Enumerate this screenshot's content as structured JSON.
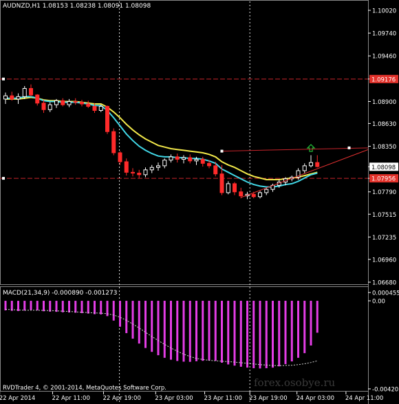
{
  "symbol_header": "AUDNZD,H1  1.08153 1.08238 1.08091 1.08098",
  "macd_header": "MACD(21,34,9) -0.000890 -0.001273",
  "copyright": "RVDTrader 4, © 2001-2014, MetaQuotes Software Corp.",
  "watermark": "forex.osobye.ru",
  "colors": {
    "background": "#000000",
    "bull_candle": "#ffffff",
    "bear_candle": "#ff2a2a",
    "ma_fast": "#41d7e6",
    "ma_slow": "#f2e84a",
    "level_line": "#c9242b",
    "trend_line": "#e03030",
    "macd_hist": "#e43de6",
    "macd_signal": "#d6d6d6",
    "current_price_box": "#ffffff",
    "level_price_box": "#e3322b",
    "up_arrow": "#23c43a"
  },
  "chart_data": [
    {
      "type": "candlestick",
      "title": "AUDNZD,H1",
      "ohlc_header": {
        "open": 1.08153,
        "high": 1.08238,
        "low": 1.08091,
        "close": 1.08098
      },
      "y_ticks": [
        "1.10020",
        "1.09740",
        "1.09460",
        "1.09176",
        "1.08900",
        "1.08630",
        "1.08350",
        "1.08098",
        "1.07956",
        "1.07790",
        "1.07515",
        "1.07235",
        "1.06960",
        "1.06680"
      ],
      "ylim": [
        1.0668,
        1.1002
      ],
      "x_ticks": [
        "22 Apr 2014",
        "22 Apr 11:00",
        "22 Apr 19:00",
        "23 Apr 03:00",
        "23 Apr 11:00",
        "23 Apr 19:00",
        "24 Apr 03:00",
        "24 Apr 11:00"
      ],
      "horizontal_levels": [
        {
          "price": 1.09176,
          "label": "1.09176"
        },
        {
          "price": 1.07956,
          "label": "1.07956"
        }
      ],
      "current_price": {
        "price": 1.08098,
        "label": "1.08098"
      },
      "resistance_line": [
        {
          "bar": 34,
          "price": 1.0829
        },
        {
          "bar": 54,
          "price": 1.0833
        }
      ],
      "trend_line": [
        {
          "bar": 37,
          "price": 1.0772
        },
        {
          "bar": 56,
          "price": 1.0828
        }
      ],
      "candles": [
        {
          "o": 1.0893,
          "h": 1.0901,
          "l": 1.0887,
          "c": 1.0897
        },
        {
          "o": 1.0897,
          "h": 1.0902,
          "l": 1.0891,
          "c": 1.0893
        },
        {
          "o": 1.0893,
          "h": 1.09,
          "l": 1.0887,
          "c": 1.0896
        },
        {
          "o": 1.0896,
          "h": 1.0909,
          "l": 1.0893,
          "c": 1.0906
        },
        {
          "o": 1.0906,
          "h": 1.0911,
          "l": 1.0896,
          "c": 1.0898
        },
        {
          "o": 1.0898,
          "h": 1.0899,
          "l": 1.0885,
          "c": 1.0888
        },
        {
          "o": 1.0888,
          "h": 1.0892,
          "l": 1.0876,
          "c": 1.088
        },
        {
          "o": 1.088,
          "h": 1.0889,
          "l": 1.0877,
          "c": 1.0886
        },
        {
          "o": 1.0886,
          "h": 1.0893,
          "l": 1.0882,
          "c": 1.0891
        },
        {
          "o": 1.0891,
          "h": 1.0894,
          "l": 1.0884,
          "c": 1.0886
        },
        {
          "o": 1.0886,
          "h": 1.0893,
          "l": 1.0883,
          "c": 1.089
        },
        {
          "o": 1.089,
          "h": 1.0894,
          "l": 1.0886,
          "c": 1.0889
        },
        {
          "o": 1.0889,
          "h": 1.0892,
          "l": 1.0884,
          "c": 1.0887
        },
        {
          "o": 1.0887,
          "h": 1.0891,
          "l": 1.0882,
          "c": 1.0884
        },
        {
          "o": 1.0884,
          "h": 1.0888,
          "l": 1.0876,
          "c": 1.0879
        },
        {
          "o": 1.0879,
          "h": 1.0886,
          "l": 1.0877,
          "c": 1.0884
        },
        {
          "o": 1.0884,
          "h": 1.0885,
          "l": 1.085,
          "c": 1.0853
        },
        {
          "o": 1.0853,
          "h": 1.0857,
          "l": 1.0824,
          "c": 1.0827
        },
        {
          "o": 1.0827,
          "h": 1.0829,
          "l": 1.0812,
          "c": 1.0816
        },
        {
          "o": 1.0816,
          "h": 1.082,
          "l": 1.0799,
          "c": 1.0803
        },
        {
          "o": 1.0803,
          "h": 1.0808,
          "l": 1.0798,
          "c": 1.0802
        },
        {
          "o": 1.0802,
          "h": 1.0806,
          "l": 1.0796,
          "c": 1.08
        },
        {
          "o": 1.08,
          "h": 1.0809,
          "l": 1.0797,
          "c": 1.0806
        },
        {
          "o": 1.0806,
          "h": 1.0812,
          "l": 1.0802,
          "c": 1.0809
        },
        {
          "o": 1.0809,
          "h": 1.0815,
          "l": 1.0805,
          "c": 1.0811
        },
        {
          "o": 1.0811,
          "h": 1.082,
          "l": 1.0808,
          "c": 1.0818
        },
        {
          "o": 1.0818,
          "h": 1.0825,
          "l": 1.0815,
          "c": 1.0822
        },
        {
          "o": 1.0822,
          "h": 1.0826,
          "l": 1.0815,
          "c": 1.0819
        },
        {
          "o": 1.0819,
          "h": 1.0824,
          "l": 1.0814,
          "c": 1.0821
        },
        {
          "o": 1.0821,
          "h": 1.0825,
          "l": 1.0814,
          "c": 1.0817
        },
        {
          "o": 1.0817,
          "h": 1.0822,
          "l": 1.0812,
          "c": 1.0819
        },
        {
          "o": 1.0819,
          "h": 1.0822,
          "l": 1.081,
          "c": 1.0814
        },
        {
          "o": 1.0814,
          "h": 1.0818,
          "l": 1.0808,
          "c": 1.0811
        },
        {
          "o": 1.0811,
          "h": 1.0816,
          "l": 1.0798,
          "c": 1.0801
        },
        {
          "o": 1.0801,
          "h": 1.0812,
          "l": 1.0775,
          "c": 1.0778
        },
        {
          "o": 1.0778,
          "h": 1.0792,
          "l": 1.0776,
          "c": 1.0789
        },
        {
          "o": 1.0789,
          "h": 1.0791,
          "l": 1.0775,
          "c": 1.0779
        },
        {
          "o": 1.0779,
          "h": 1.0784,
          "l": 1.0771,
          "c": 1.0774
        },
        {
          "o": 1.0774,
          "h": 1.0779,
          "l": 1.077,
          "c": 1.0776
        },
        {
          "o": 1.0776,
          "h": 1.0779,
          "l": 1.0771,
          "c": 1.0773
        },
        {
          "o": 1.0773,
          "h": 1.078,
          "l": 1.0771,
          "c": 1.0778
        },
        {
          "o": 1.0778,
          "h": 1.0784,
          "l": 1.0775,
          "c": 1.0782
        },
        {
          "o": 1.0782,
          "h": 1.0789,
          "l": 1.0779,
          "c": 1.0787
        },
        {
          "o": 1.0787,
          "h": 1.0794,
          "l": 1.0784,
          "c": 1.0791
        },
        {
          "o": 1.0791,
          "h": 1.0797,
          "l": 1.0787,
          "c": 1.0795
        },
        {
          "o": 1.0795,
          "h": 1.0799,
          "l": 1.0792,
          "c": 1.0797
        },
        {
          "o": 1.0797,
          "h": 1.0808,
          "l": 1.0794,
          "c": 1.0805
        },
        {
          "o": 1.0805,
          "h": 1.0814,
          "l": 1.0802,
          "c": 1.0811
        },
        {
          "o": 1.0811,
          "h": 1.0824,
          "l": 1.0809,
          "c": 1.0815
        },
        {
          "o": 1.0815,
          "h": 1.0824,
          "l": 1.0809,
          "c": 1.081
        }
      ],
      "ma_fast_values": [
        1.0894,
        1.0894,
        1.0894,
        1.0896,
        1.0896,
        1.0894,
        1.0891,
        1.089,
        1.089,
        1.0889,
        1.0889,
        1.0889,
        1.0888,
        1.0887,
        1.0885,
        1.0885,
        1.0879,
        1.087,
        1.086,
        1.085,
        1.0842,
        1.0835,
        1.083,
        1.0826,
        1.0823,
        1.0822,
        1.0822,
        1.0821,
        1.0821,
        1.082,
        1.082,
        1.0819,
        1.0817,
        1.0814,
        1.0807,
        1.0803,
        1.0799,
        1.0795,
        1.0791,
        1.0788,
        1.0786,
        1.0785,
        1.0785,
        1.0786,
        1.0788,
        1.0789,
        1.0792,
        1.0796,
        1.08,
        1.0802
      ],
      "ma_slow_values": [
        1.0893,
        1.0893,
        1.0893,
        1.0894,
        1.0895,
        1.0894,
        1.0892,
        1.0891,
        1.0891,
        1.089,
        1.089,
        1.089,
        1.0889,
        1.0888,
        1.0887,
        1.0887,
        1.0883,
        1.0877,
        1.087,
        1.0862,
        1.0855,
        1.0849,
        1.0844,
        1.084,
        1.0836,
        1.0834,
        1.0832,
        1.0831,
        1.083,
        1.0829,
        1.0828,
        1.0827,
        1.0825,
        1.0822,
        1.0816,
        1.0812,
        1.0809,
        1.0805,
        1.0801,
        1.0798,
        1.0796,
        1.0794,
        1.0794,
        1.0794,
        1.0795,
        1.0796,
        1.0797,
        1.0799,
        1.0801,
        1.0803
      ],
      "signal_arrow": {
        "bar": 48,
        "price": 1.0832,
        "direction": "up"
      }
    },
    {
      "type": "bar",
      "title": "MACD(21,34,9)",
      "values_header": {
        "macd": -0.00089,
        "signal": -0.001273
      },
      "y_ticks": [
        "0.000455",
        "0.00",
        "-0.004205"
      ],
      "ylim": [
        -0.004205,
        0.000455
      ],
      "histogram": [
        -0.00045,
        -0.00047,
        -0.00048,
        -0.00046,
        -0.00043,
        -0.00045,
        -0.00049,
        -0.00051,
        -0.00052,
        -0.00054,
        -0.00055,
        -0.00056,
        -0.00058,
        -0.0006,
        -0.00063,
        -0.00064,
        -0.00072,
        -0.00093,
        -0.00122,
        -0.00152,
        -0.00178,
        -0.00201,
        -0.00222,
        -0.0024,
        -0.00256,
        -0.00268,
        -0.00277,
        -0.00283,
        -0.00286,
        -0.00287,
        -0.00284,
        -0.00282,
        -0.0028,
        -0.00282,
        -0.00291,
        -0.00299,
        -0.00305,
        -0.0031,
        -0.00314,
        -0.00317,
        -0.00318,
        -0.00317,
        -0.00314,
        -0.00308,
        -0.00298,
        -0.00285,
        -0.00268,
        -0.00246,
        -0.0021,
        -0.0015
      ],
      "signal": [
        -0.0004,
        -0.00042,
        -0.00043,
        -0.00044,
        -0.00044,
        -0.00044,
        -0.00045,
        -0.00046,
        -0.00047,
        -0.00049,
        -0.0005,
        -0.00052,
        -0.00054,
        -0.00055,
        -0.00057,
        -0.00058,
        -0.00061,
        -0.00067,
        -0.00077,
        -0.00092,
        -0.00109,
        -0.00128,
        -0.00148,
        -0.00168,
        -0.00187,
        -0.00205,
        -0.00222,
        -0.00237,
        -0.00251,
        -0.00262,
        -0.00271,
        -0.00276,
        -0.0028,
        -0.00282,
        -0.00284,
        -0.00286,
        -0.00288,
        -0.00291,
        -0.00294,
        -0.00297,
        -0.003,
        -0.00302,
        -0.00304,
        -0.00305,
        -0.00304,
        -0.00303,
        -0.003,
        -0.00296,
        -0.0029,
        -0.00282
      ]
    }
  ]
}
